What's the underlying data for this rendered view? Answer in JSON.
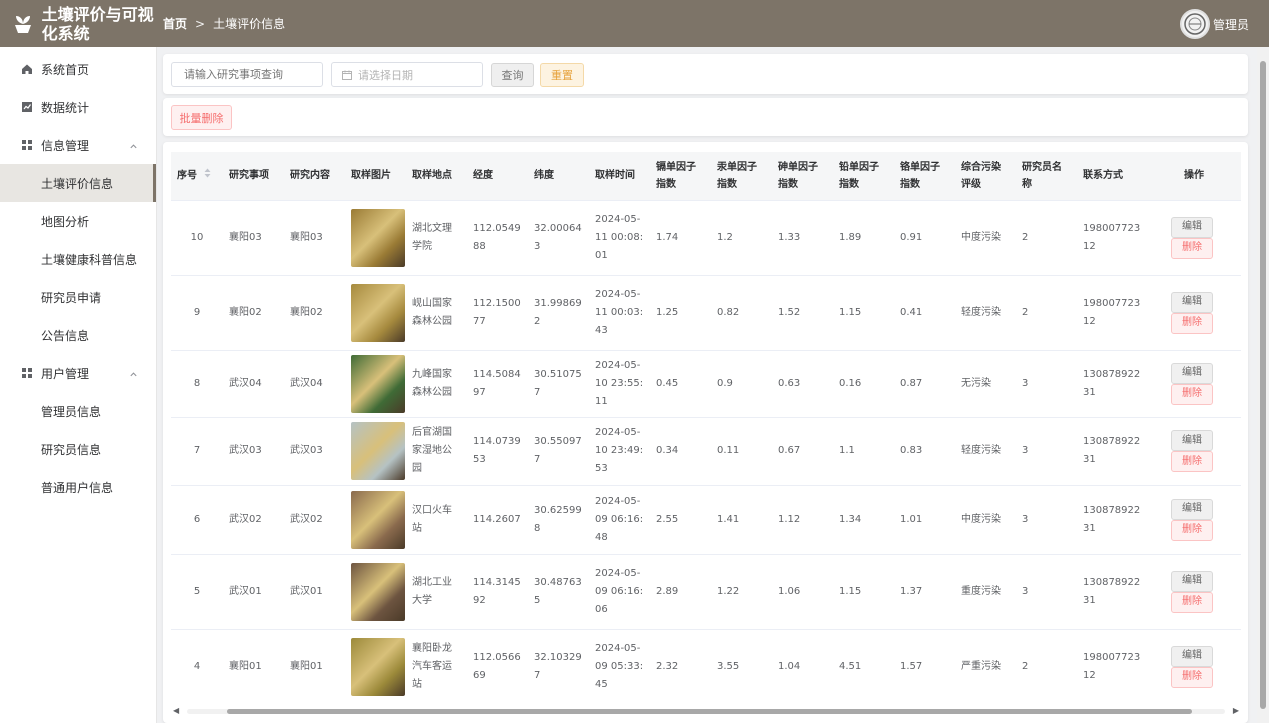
{
  "app": {
    "title": "土壤评价与可视化系统",
    "user": "管理员"
  },
  "breadcrumb": {
    "home": "首页",
    "separator": ">",
    "current": "土壤评价信息"
  },
  "sidebar": {
    "items": [
      {
        "label": "系统首页",
        "icon": "home-icon"
      },
      {
        "label": "数据统计",
        "icon": "chart-icon"
      },
      {
        "label": "信息管理",
        "icon": "grid-icon",
        "expanded": true,
        "children": [
          "土壤评价信息",
          "地图分析",
          "土壤健康科普信息",
          "研究员申请",
          "公告信息"
        ]
      },
      {
        "label": "用户管理",
        "icon": "grid-icon",
        "expanded": true,
        "children": [
          "管理员信息",
          "研究员信息",
          "普通用户信息"
        ]
      }
    ],
    "active": "土壤评价信息"
  },
  "search": {
    "topic_placeholder": "请输入研究事项查询",
    "date_placeholder": "请选择日期",
    "query_label": "查询",
    "reset_label": "重置"
  },
  "actions": {
    "batch_delete_label": "批量删除"
  },
  "table": {
    "columns": [
      "序号",
      "研究事项",
      "研究内容",
      "取样图片",
      "取样地点",
      "经度",
      "纬度",
      "取样时间",
      "镉单因子指数",
      "汞单因子指数",
      "砷单因子指数",
      "铅单因子指数",
      "铬单因子指数",
      "综合污染评级",
      "研究员名称",
      "联系方式",
      "操作"
    ],
    "edit_label": "编辑",
    "delete_label": "删除",
    "rows": [
      {
        "id": "10",
        "topic": "襄阳03",
        "content": "襄阳03",
        "place": "湖北文理学院",
        "lng": "112.054988",
        "lat": "32.000643",
        "time": "2024-05-11 00:08:01",
        "cd": "1.74",
        "hg": "1.2",
        "as": "1.33",
        "pb": "1.89",
        "cr": "0.91",
        "grade": "中度污染",
        "researcher": "2",
        "phone": "19800772312",
        "img_color": "#9a7b35"
      },
      {
        "id": "9",
        "topic": "襄阳02",
        "content": "襄阳02",
        "place": "岘山国家森林公园",
        "lng": "112.150077",
        "lat": "31.998692",
        "time": "2024-05-11 00:03:43",
        "cd": "1.25",
        "hg": "0.82",
        "as": "1.52",
        "pb": "1.15",
        "cr": "0.41",
        "grade": "轻度污染",
        "researcher": "2",
        "phone": "19800772312",
        "img_color": "#a68a3e"
      },
      {
        "id": "8",
        "topic": "武汉04",
        "content": "武汉04",
        "place": "九峰国家森林公园",
        "lng": "114.508497",
        "lat": "30.510757",
        "time": "2024-05-10 23:55:11",
        "cd": "0.45",
        "hg": "0.9",
        "as": "0.63",
        "pb": "0.16",
        "cr": "0.87",
        "grade": "无污染",
        "researcher": "3",
        "phone": "13087892231",
        "img_color": "#3f6b36"
      },
      {
        "id": "7",
        "topic": "武汉03",
        "content": "武汉03",
        "place": "后官湖国家湿地公园",
        "lng": "114.073953",
        "lat": "30.550977",
        "time": "2024-05-10 23:49:53",
        "cd": "0.34",
        "hg": "0.11",
        "as": "0.67",
        "pb": "1.1",
        "cr": "0.83",
        "grade": "轻度污染",
        "researcher": "3",
        "phone": "13087892231",
        "img_color": "#b5c2c4"
      },
      {
        "id": "6",
        "topic": "武汉02",
        "content": "武汉02",
        "place": "汉口火车站",
        "lng": "114.2607",
        "lat": "30.625998",
        "time": "2024-05-09 06:16:48",
        "cd": "2.55",
        "hg": "1.41",
        "as": "1.12",
        "pb": "1.34",
        "cr": "1.01",
        "grade": "中度污染",
        "researcher": "3",
        "phone": "13087892231",
        "img_color": "#8a6a4d"
      },
      {
        "id": "5",
        "topic": "武汉01",
        "content": "武汉01",
        "place": "湖北工业大学",
        "lng": "114.314592",
        "lat": "30.487635",
        "time": "2024-05-09 06:16:06",
        "cd": "2.89",
        "hg": "1.22",
        "as": "1.06",
        "pb": "1.15",
        "cr": "1.37",
        "grade": "重度污染",
        "researcher": "3",
        "phone": "13087892231",
        "img_color": "#6d5440"
      },
      {
        "id": "4",
        "topic": "襄阳01",
        "content": "襄阳01",
        "place": "襄阳卧龙汽车客运站",
        "lng": "112.056669",
        "lat": "32.103297",
        "time": "2024-05-09 05:33:45",
        "cd": "2.32",
        "hg": "3.55",
        "as": "1.04",
        "pb": "4.51",
        "cr": "1.57",
        "grade": "严重污染",
        "researcher": "2",
        "phone": "19800772312",
        "img_color": "#9c8a3a"
      }
    ]
  }
}
